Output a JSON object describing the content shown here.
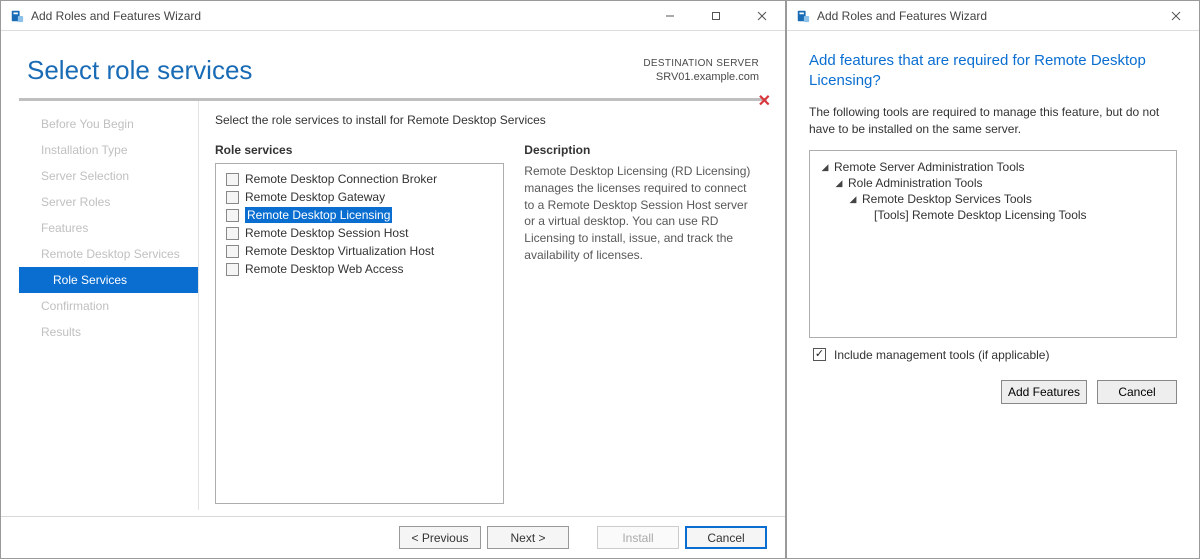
{
  "main": {
    "window_title": "Add Roles and Features Wizard",
    "page_title": "Select role services",
    "destination_label": "DESTINATION SERVER",
    "destination_server": "SRV01.example.com",
    "instruction": "Select the role services to install for Remote Desktop Services",
    "roles_heading": "Role services",
    "description_heading": "Description",
    "description_text": "Remote Desktop Licensing (RD Licensing) manages the licenses required to connect to a Remote Desktop Session Host server or a virtual desktop. You can use RD Licensing to install, issue, and track the availability of licenses.",
    "sidebar": [
      {
        "label": "Before You Begin",
        "active": false,
        "sub": false
      },
      {
        "label": "Installation Type",
        "active": false,
        "sub": false
      },
      {
        "label": "Server Selection",
        "active": false,
        "sub": false
      },
      {
        "label": "Server Roles",
        "active": false,
        "sub": false
      },
      {
        "label": "Features",
        "active": false,
        "sub": false
      },
      {
        "label": "Remote Desktop Services",
        "active": false,
        "sub": false
      },
      {
        "label": "Role Services",
        "active": true,
        "sub": true
      },
      {
        "label": "Confirmation",
        "active": false,
        "sub": false
      },
      {
        "label": "Results",
        "active": false,
        "sub": false
      }
    ],
    "roles": [
      {
        "label": "Remote Desktop Connection Broker",
        "selected": false
      },
      {
        "label": "Remote Desktop Gateway",
        "selected": false
      },
      {
        "label": "Remote Desktop Licensing",
        "selected": true
      },
      {
        "label": "Remote Desktop Session Host",
        "selected": false
      },
      {
        "label": "Remote Desktop Virtualization Host",
        "selected": false
      },
      {
        "label": "Remote Desktop Web Access",
        "selected": false
      }
    ],
    "buttons": {
      "previous": "< Previous",
      "next": "Next >",
      "install": "Install",
      "cancel": "Cancel"
    }
  },
  "dialog": {
    "window_title": "Add Roles and Features Wizard",
    "heading": "Add features that are required for Remote Desktop Licensing?",
    "paragraph": "The following tools are required to manage this feature, but do not have to be installed on the same server.",
    "tree": [
      {
        "label": "Remote Server Administration Tools",
        "depth": 0,
        "expander": true
      },
      {
        "label": "Role Administration Tools",
        "depth": 1,
        "expander": true
      },
      {
        "label": "Remote Desktop Services Tools",
        "depth": 2,
        "expander": true
      },
      {
        "label": "[Tools] Remote Desktop Licensing Tools",
        "depth": 3,
        "expander": false
      }
    ],
    "include_label": "Include management tools (if applicable)",
    "include_checked": true,
    "buttons": {
      "add": "Add Features",
      "cancel": "Cancel"
    }
  }
}
